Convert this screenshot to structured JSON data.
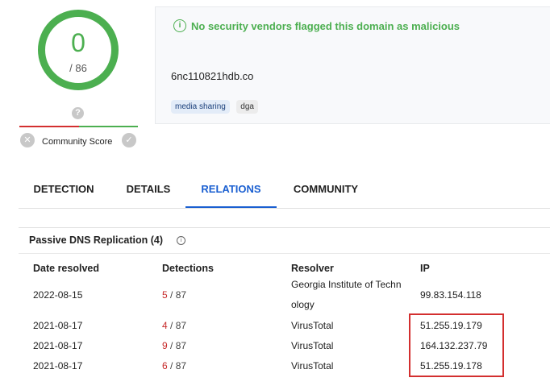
{
  "score": {
    "value": "0",
    "total": "/ 86"
  },
  "community": {
    "label": "Community Score",
    "question_icon": "?",
    "reject_icon": "✕",
    "accept_icon": "✓"
  },
  "header": {
    "status_icon": "i",
    "status": "No security vendors flagged this domain as malicious",
    "domain": "6nc110821hdb.co",
    "tags": [
      "media sharing",
      "dga"
    ]
  },
  "tabs": [
    {
      "label": "DETECTION",
      "active": false
    },
    {
      "label": "DETAILS",
      "active": false
    },
    {
      "label": "RELATIONS",
      "active": true
    },
    {
      "label": "COMMUNITY",
      "active": false
    }
  ],
  "section": {
    "title": "Passive DNS Replication",
    "count": "(4)",
    "info_icon": "i"
  },
  "table": {
    "headers": [
      "Date resolved",
      "Detections",
      "Resolver",
      "IP"
    ],
    "rows": [
      {
        "date": "2022-08-15",
        "det_num": "5",
        "det_total": " / 87",
        "resolver": "Georgia Institute of Techn ology",
        "ip": "99.83.154.118"
      },
      {
        "date": "2021-08-17",
        "det_num": "4",
        "det_total": " / 87",
        "resolver": "VirusTotal",
        "ip": "51.255.19.179"
      },
      {
        "date": "2021-08-17",
        "det_num": "9",
        "det_total": " / 87",
        "resolver": "VirusTotal",
        "ip": "164.132.237.79"
      },
      {
        "date": "2021-08-17",
        "det_num": "6",
        "det_total": " / 87",
        "resolver": "VirusTotal",
        "ip": "51.255.19.178"
      }
    ]
  },
  "colors": {
    "green": "#4caf50",
    "red": "#d32f2f",
    "blue": "#1a5fd1"
  }
}
